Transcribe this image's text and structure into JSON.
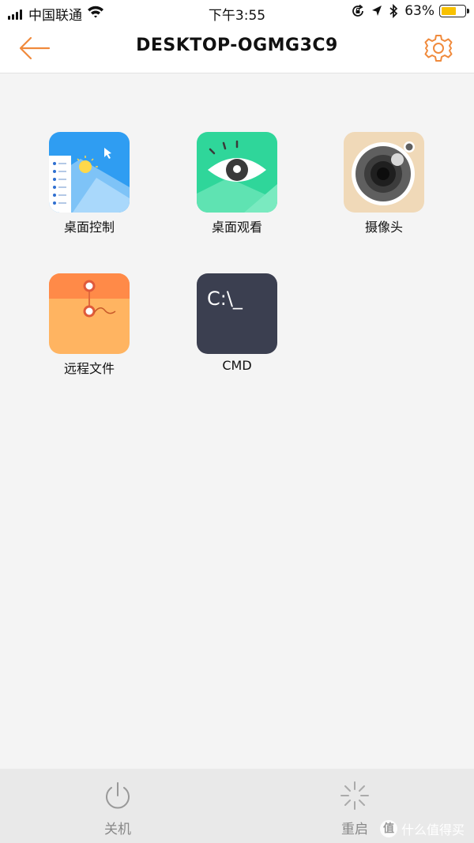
{
  "status_bar": {
    "carrier": "中国联通",
    "time": "下午3:55",
    "battery_percent": "63%",
    "battery_level": 0.63
  },
  "nav": {
    "title": "DESKTOP-OGMG3C9",
    "back_icon": "arrow-left-icon",
    "settings_icon": "gear-icon",
    "accent_color": "#f08a3c"
  },
  "apps": [
    {
      "label": "桌面控制",
      "icon": "desktop-control-icon"
    },
    {
      "label": "桌面观看",
      "icon": "eye-icon"
    },
    {
      "label": "摄像头",
      "icon": "camera-icon"
    },
    {
      "label": "远程文件",
      "icon": "file-folder-icon"
    },
    {
      "label": "CMD",
      "icon": "terminal-icon",
      "tile_text": "C:\\_"
    }
  ],
  "bottom_bar": {
    "shutdown_label": "关机",
    "restart_label": "重启"
  },
  "watermark": {
    "logo_text": "值",
    "text": "什么值得买"
  }
}
